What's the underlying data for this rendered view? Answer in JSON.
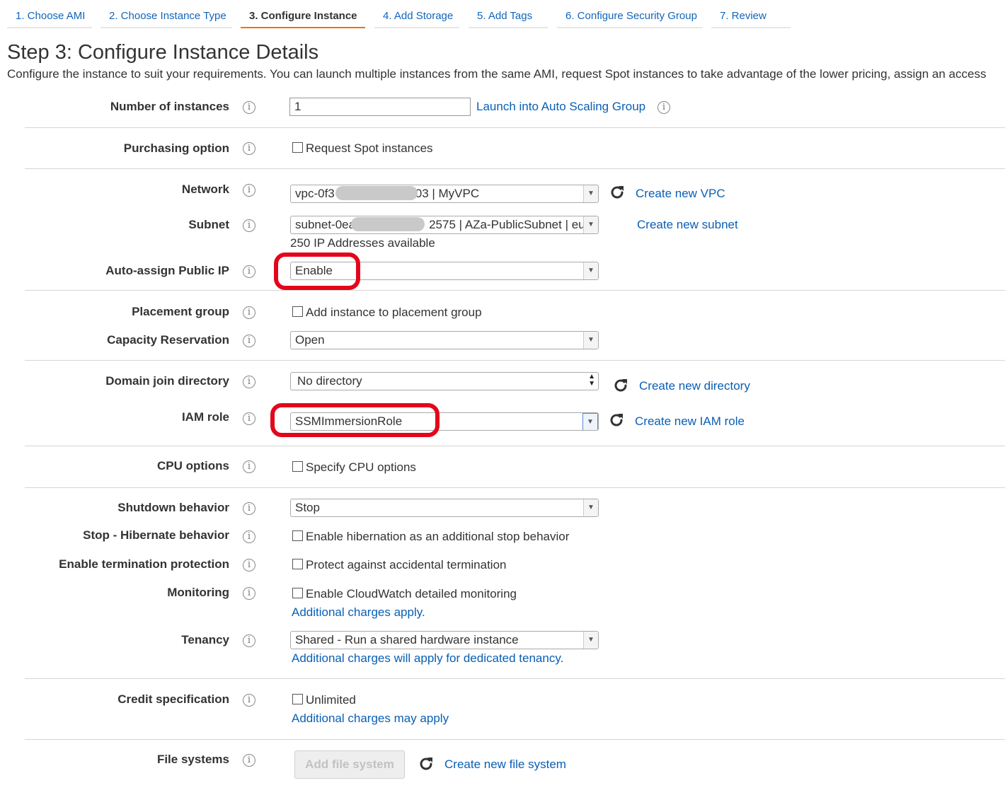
{
  "tabs": [
    {
      "label": "1. Choose AMI"
    },
    {
      "label": "2. Choose Instance Type"
    },
    {
      "label": "3. Configure Instance"
    },
    {
      "label": "4. Add Storage"
    },
    {
      "label": "5. Add Tags"
    },
    {
      "label": "6. Configure Security Group"
    },
    {
      "label": "7. Review"
    }
  ],
  "page": {
    "title": "Step 3: Configure Instance Details",
    "description": "Configure the instance to suit your requirements. You can launch multiple instances from the same AMI, request Spot instances to take advantage of the lower pricing, assign an access"
  },
  "fields": {
    "number_of_instances": {
      "label": "Number of instances",
      "value": "1",
      "link": "Launch into Auto Scaling Group"
    },
    "purchasing_option": {
      "label": "Purchasing option",
      "checkbox": "Request Spot instances"
    },
    "network": {
      "label": "Network",
      "value_prefix": "vpc-0f3",
      "value_suffix": "03 | MyVPC",
      "link": "Create new VPC"
    },
    "subnet": {
      "label": "Subnet",
      "value_prefix": "subnet-0ea",
      "value_suffix": "2575 | AZa-PublicSubnet | eu",
      "note": "250 IP Addresses available",
      "link": "Create new subnet"
    },
    "auto_assign_ip": {
      "label": "Auto-assign Public IP",
      "value": "Enable"
    },
    "placement_group": {
      "label": "Placement group",
      "checkbox": "Add instance to placement group"
    },
    "capacity_reservation": {
      "label": "Capacity Reservation",
      "value": "Open"
    },
    "domain_join": {
      "label": "Domain join directory",
      "value": "No directory",
      "link": "Create new directory"
    },
    "iam_role": {
      "label": "IAM role",
      "value": "SSMImmersionRole",
      "link": "Create new IAM role"
    },
    "cpu_options": {
      "label": "CPU options",
      "checkbox": "Specify CPU options"
    },
    "shutdown_behavior": {
      "label": "Shutdown behavior",
      "value": "Stop"
    },
    "hibernate": {
      "label": "Stop - Hibernate behavior",
      "checkbox": "Enable hibernation as an additional stop behavior"
    },
    "termination_protection": {
      "label": "Enable termination protection",
      "checkbox": "Protect against accidental termination"
    },
    "monitoring": {
      "label": "Monitoring",
      "checkbox": "Enable CloudWatch detailed monitoring",
      "link": "Additional charges apply."
    },
    "tenancy": {
      "label": "Tenancy",
      "value": "Shared - Run a shared hardware instance",
      "link": "Additional charges will apply for dedicated tenancy."
    },
    "credit_spec": {
      "label": "Credit specification",
      "checkbox": "Unlimited",
      "link": "Additional charges may apply"
    },
    "file_systems": {
      "label": "File systems",
      "button": "Add file system",
      "link": "Create new file system"
    }
  },
  "icons": {
    "info": "i"
  },
  "colors": {
    "link": "#0a5fb4",
    "active_tab_border": "#ec7211",
    "highlight": "#e3061b"
  }
}
